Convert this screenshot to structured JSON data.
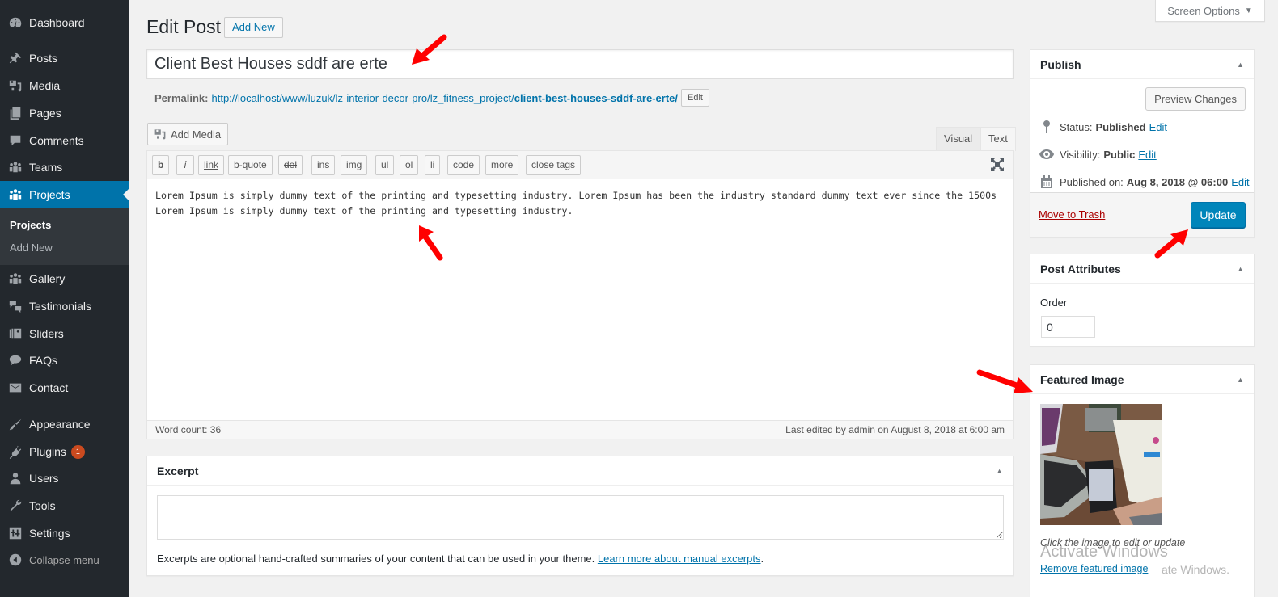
{
  "sidebar": {
    "items": [
      {
        "label": "Dashboard",
        "icon": "dashboard-icon"
      },
      {
        "label": "Posts",
        "icon": "pin-icon"
      },
      {
        "label": "Media",
        "icon": "media-icon"
      },
      {
        "label": "Pages",
        "icon": "pages-icon"
      },
      {
        "label": "Comments",
        "icon": "comment-icon"
      },
      {
        "label": "Teams",
        "icon": "groups-icon"
      },
      {
        "label": "Projects",
        "icon": "groups-icon",
        "active": true
      },
      {
        "label": "Gallery",
        "icon": "groups-icon"
      },
      {
        "label": "Testimonials",
        "icon": "testimonial-icon"
      },
      {
        "label": "Sliders",
        "icon": "slides-icon"
      },
      {
        "label": "FAQs",
        "icon": "format-chat-icon"
      },
      {
        "label": "Contact",
        "icon": "email-icon"
      },
      {
        "label": "Appearance",
        "icon": "paintbrush-icon"
      },
      {
        "label": "Plugins",
        "icon": "plugin-icon",
        "badge": "1"
      },
      {
        "label": "Users",
        "icon": "user-icon"
      },
      {
        "label": "Tools",
        "icon": "wrench-icon"
      },
      {
        "label": "Settings",
        "icon": "settings-icon"
      },
      {
        "label": "Collapse menu",
        "icon": "collapse-icon"
      }
    ],
    "submenu": [
      {
        "label": "Projects",
        "current": true
      },
      {
        "label": "Add New"
      }
    ]
  },
  "screen_options": {
    "label": "Screen Options"
  },
  "header": {
    "title": "Edit Post",
    "add_new_label": "Add New"
  },
  "post": {
    "title": "Client Best Houses sddf are erte",
    "permalink_label": "Permalink:",
    "permalink_base": "http://localhost/www/luzuk/lz-interior-decor-pro/lz_fitness_project/",
    "permalink_slug": "client-best-houses-sddf-are-erte/",
    "permalink_edit_label": "Edit"
  },
  "editor": {
    "add_media_label": "Add Media",
    "tabs": {
      "visual": "Visual",
      "text": "Text"
    },
    "active_tab": "Text",
    "quicktags": [
      "b",
      "i",
      "link",
      "b-quote",
      "del",
      "ins",
      "img",
      "ul",
      "ol",
      "li",
      "code",
      "more",
      "close tags"
    ],
    "content": "Lorem Ipsum is simply dummy text of the printing and typesetting industry. Lorem Ipsum has been the industry standard dummy text ever since the 1500s Lorem Ipsum is simply dummy text of the printing and typesetting industry.",
    "word_count": "Word count: 36",
    "last_edited": "Last edited by admin on August 8, 2018 at 6:00 am"
  },
  "excerpt": {
    "title": "Excerpt",
    "value": "",
    "help_text": "Excerpts are optional hand-crafted summaries of your content that can be used in your theme. ",
    "help_link": "Learn more about manual excerpts",
    "help_end": "."
  },
  "publish": {
    "title": "Publish",
    "preview_label": "Preview Changes",
    "status_label": "Status:",
    "status_value": "Published",
    "visibility_label": "Visibility:",
    "visibility_value": "Public",
    "published_label": "Published on:",
    "published_value": "Aug 8, 2018 @ 06:00",
    "edit_label": "Edit",
    "trash_label": "Move to Trash",
    "update_label": "Update"
  },
  "attributes": {
    "title": "Post Attributes",
    "order_label": "Order",
    "order_value": "0"
  },
  "featured": {
    "title": "Featured Image",
    "caption": "Click the image to edit or update",
    "remove_label": "Remove featured image"
  },
  "watermark": {
    "line1": "Activate Windows",
    "line2": "ate Windows."
  },
  "colors": {
    "sidebar_bg": "#23282d",
    "active": "#0073aa",
    "button_primary": "#0085ba",
    "annotation_arrow": "#ff0000",
    "trash": "#aa0000",
    "badge": "#ca4a1f"
  }
}
